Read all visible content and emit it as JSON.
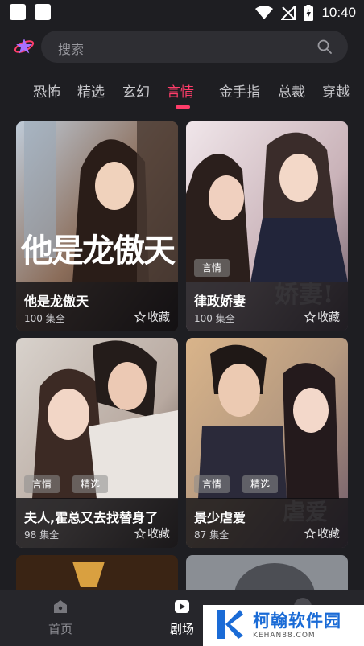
{
  "status_bar": {
    "time": "10:40"
  },
  "search": {
    "placeholder": "搜索"
  },
  "tabs": [
    {
      "label": "恐怖"
    },
    {
      "label": "精选"
    },
    {
      "label": "玄幻"
    },
    {
      "label": "言情",
      "active": true
    },
    {
      "label": "金手指"
    },
    {
      "label": "总裁"
    },
    {
      "label": "穿越"
    }
  ],
  "dramas": [
    {
      "title": "他是龙傲天",
      "episodes": "100 集全",
      "fav_label": "收藏",
      "tags": [],
      "poster_text": "他是龙傲天"
    },
    {
      "title": "律政娇妻",
      "episodes": "100 集全",
      "fav_label": "收藏",
      "tags": [
        "言情"
      ],
      "poster_text": "娇妻!"
    },
    {
      "title": "夫人,霍总又去找替身了",
      "episodes": "98 集全",
      "fav_label": "收藏",
      "tags": [
        "言情",
        "精选"
      ]
    },
    {
      "title": "景少虐爱",
      "episodes": "87 集全",
      "fav_label": "收藏",
      "tags": [
        "言情",
        "精选"
      ],
      "poster_text": "虐爱"
    }
  ],
  "bottom_nav": [
    {
      "label": "首页",
      "icon": "home-icon"
    },
    {
      "label": "剧场",
      "icon": "theater-icon",
      "active": true
    }
  ],
  "watermark": {
    "name": "柯翰软件园",
    "domain": "KEHAN88.COM"
  },
  "colors": {
    "accent": "#ff3d6a",
    "background": "#1e1e22"
  }
}
